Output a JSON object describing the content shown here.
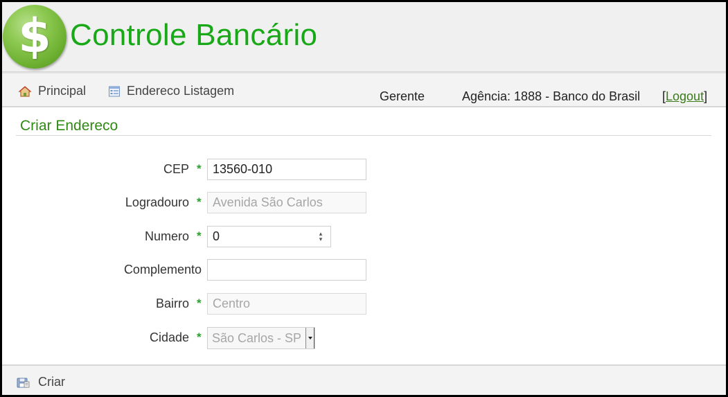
{
  "header": {
    "logo_symbol": "$",
    "title": "Controle Bancário",
    "title_color": "#18a818"
  },
  "nav": {
    "items": [
      {
        "label": "Principal",
        "icon": "home-icon"
      },
      {
        "label": "Endereco Listagem",
        "icon": "list-document-icon"
      }
    ],
    "user_role": "Gerente",
    "agency": "Agência: 1888 - Banco do Brasil",
    "logout_open": "[",
    "logout_label": "Logout",
    "logout_close": "]"
  },
  "page": {
    "title": "Criar Endereco",
    "title_color": "#2f8a14"
  },
  "form": {
    "required_marker": "*",
    "cep": {
      "label": "CEP",
      "value": "13560-010",
      "required": true
    },
    "logradouro": {
      "label": "Logradouro",
      "value": "Avenida São Carlos",
      "required": true,
      "disabled": true
    },
    "numero": {
      "label": "Numero",
      "value": "0",
      "required": true,
      "type": "number"
    },
    "complemento": {
      "label": "Complemento",
      "value": "",
      "required": false
    },
    "bairro": {
      "label": "Bairro",
      "value": "Centro",
      "required": true,
      "disabled": true
    },
    "cidade": {
      "label": "Cidade",
      "selected": "São Carlos - SP",
      "required": true,
      "disabled": true
    }
  },
  "footer": {
    "submit_label": "Criar",
    "submit_icon": "save-icon"
  }
}
